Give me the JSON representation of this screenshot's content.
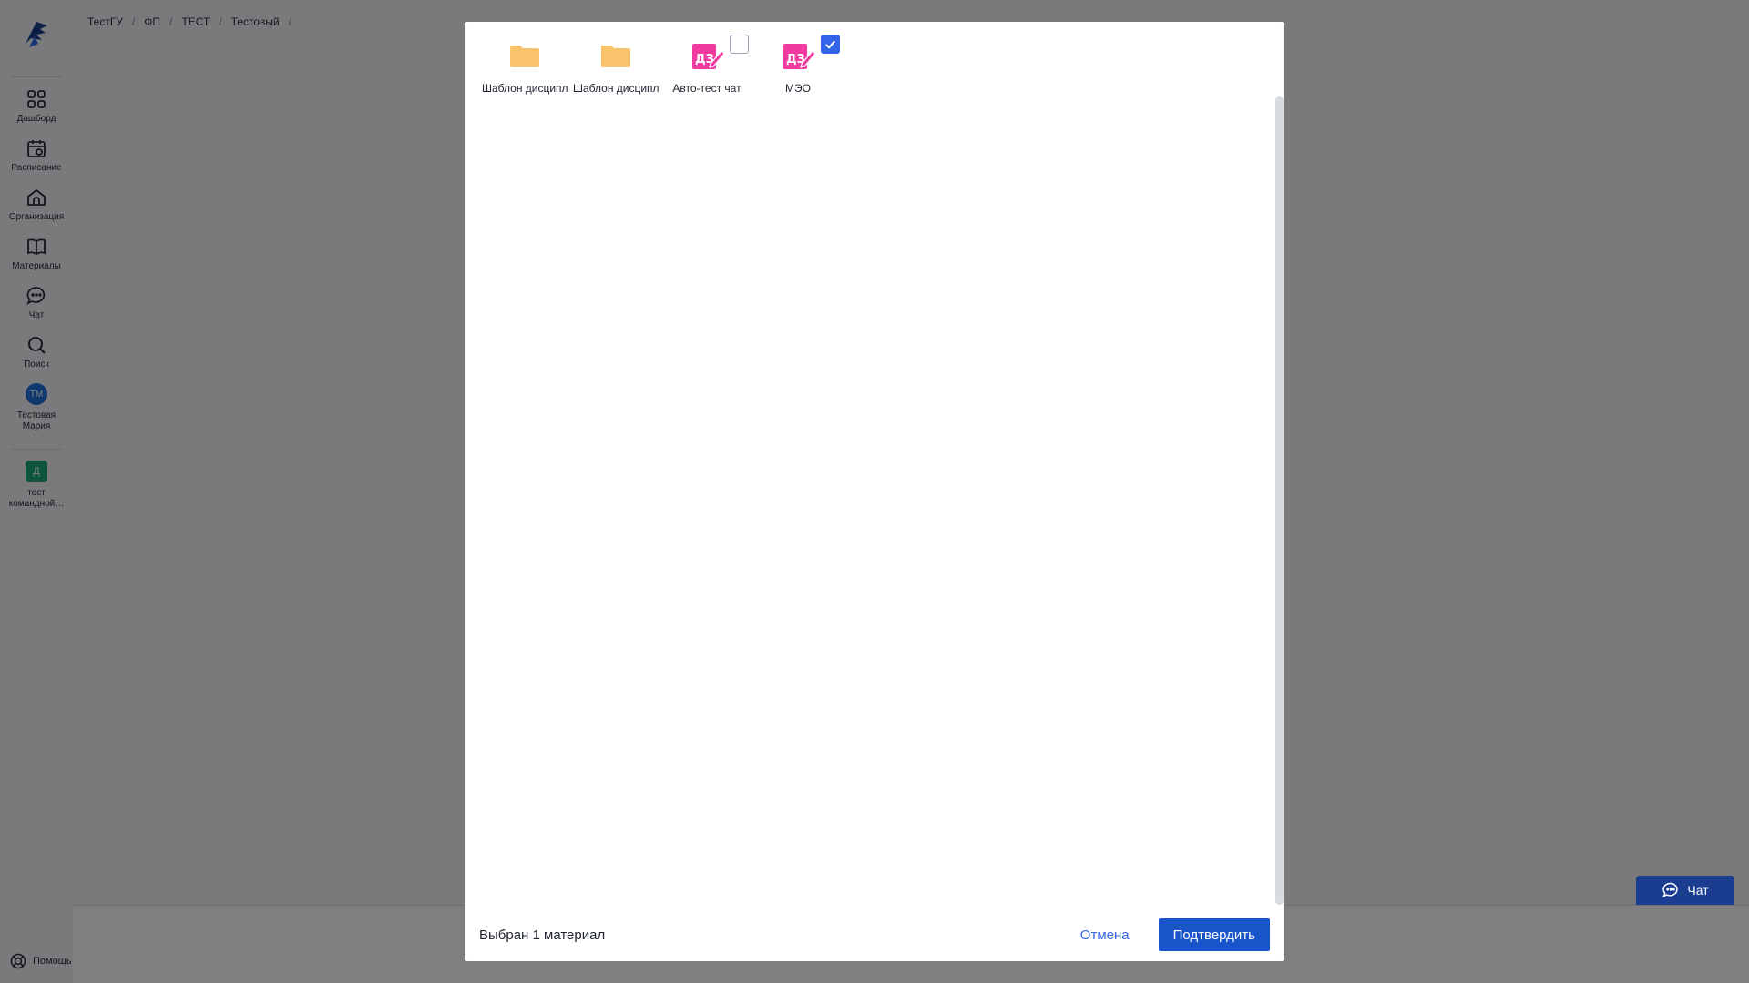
{
  "sidebar": {
    "items": [
      {
        "label": "Дашборд",
        "icon": "dashboard-icon"
      },
      {
        "label": "Расписание",
        "icon": "calendar-icon"
      },
      {
        "label": "Организация",
        "icon": "home-icon"
      },
      {
        "label": "Материалы",
        "icon": "book-icon"
      },
      {
        "label": "Чат",
        "icon": "chat-icon"
      },
      {
        "label": "Поиск",
        "icon": "search-icon"
      }
    ],
    "user": {
      "initials": "ТМ",
      "name_line1": "Тестовая",
      "name_line2": "Мария"
    },
    "team": {
      "initial": "Д",
      "name_line1": "тест",
      "name_line2": "командной…"
    },
    "help_label": "Помощь"
  },
  "breadcrumb": [
    "ТестГУ",
    "ФП",
    "ТЕСТ",
    "Тестовый"
  ],
  "breadcrumb_sep": "/",
  "chat_button": {
    "label": "Чат"
  },
  "modal": {
    "files": [
      {
        "name": "Шаблон дисциплины",
        "type": "folder",
        "selectable": false,
        "checked": false
      },
      {
        "name": "Шаблон дисциплины",
        "type": "folder",
        "selectable": false,
        "checked": false
      },
      {
        "name": "Авто-тест чат",
        "type": "assignment",
        "selectable": true,
        "checked": false
      },
      {
        "name": "МЭО",
        "type": "assignment",
        "selectable": true,
        "checked": true
      }
    ],
    "selection_text": "Выбран 1 материал",
    "cancel_label": "Отмена",
    "confirm_label": "Подтвердить"
  },
  "colors": {
    "folder": "#f8c36a",
    "assignment": "#f03aa0",
    "accent": "#3465e8",
    "confirm_bg": "#1955c9",
    "chat_bg": "#1a3d8f"
  }
}
